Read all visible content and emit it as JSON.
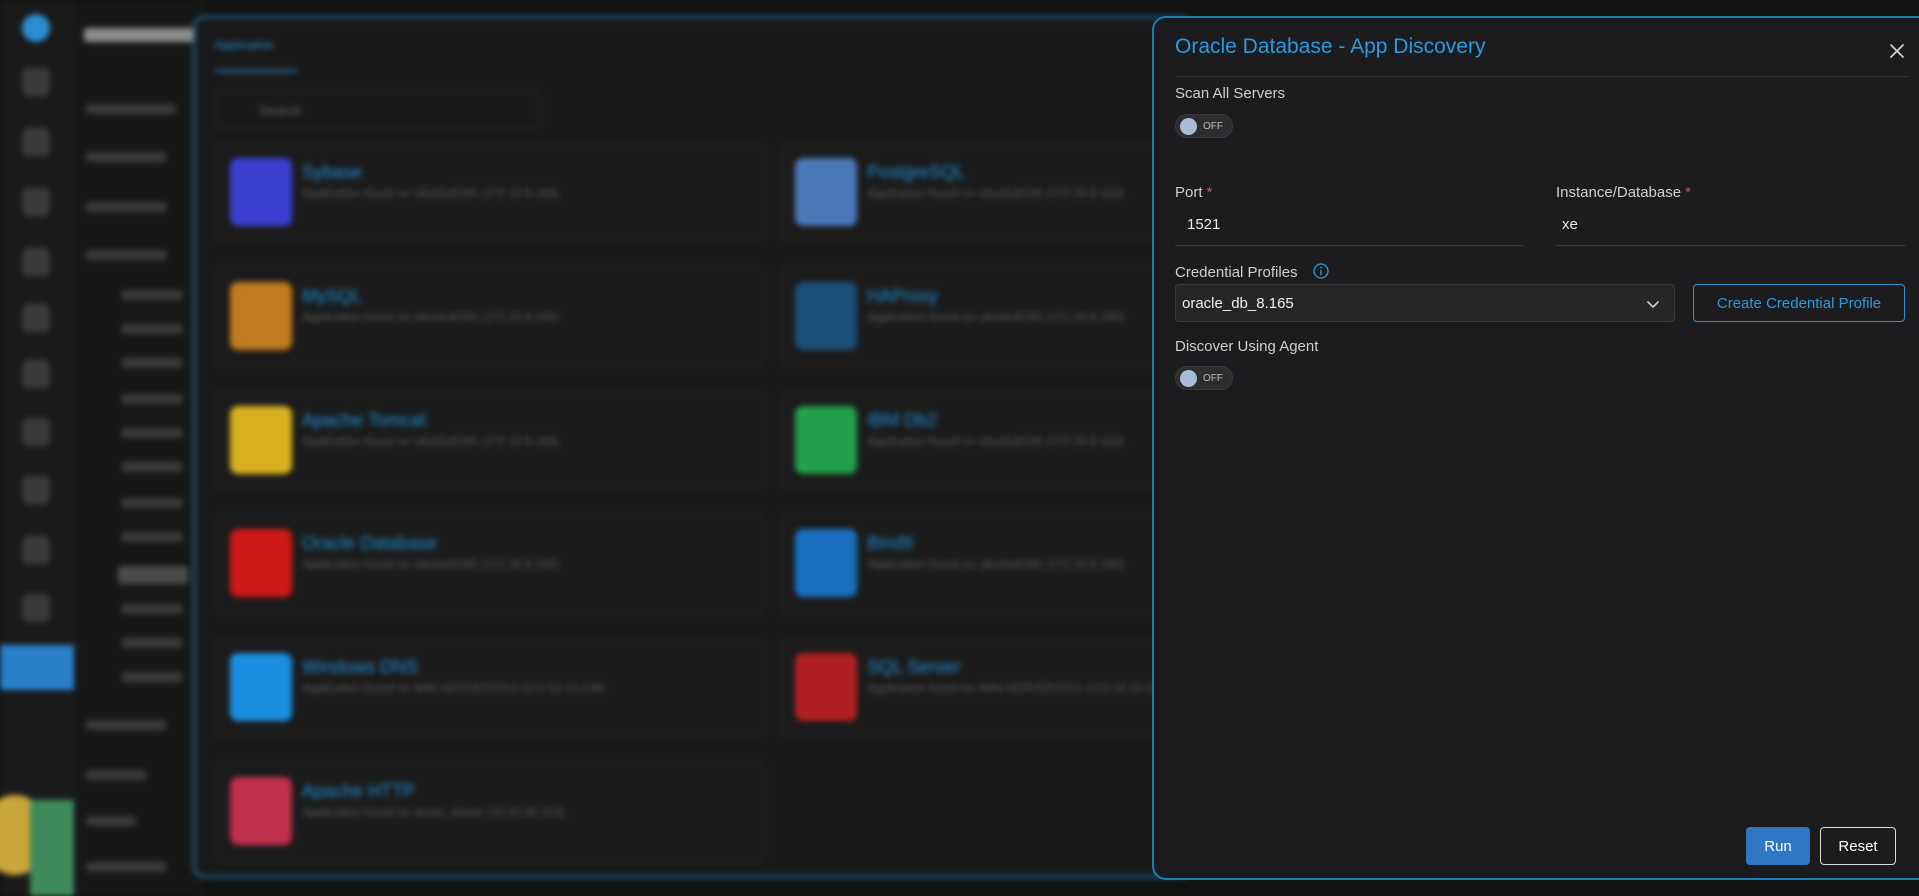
{
  "drawer": {
    "title": "Oracle Database - App Discovery",
    "scan_all_servers_label": "Scan All Servers",
    "scan_all_servers_state": "OFF",
    "port_label": "Port",
    "port_value": "1521",
    "instance_label": "Instance/Database",
    "instance_value": "xe",
    "required_mark": "*",
    "credential_label": "Credential Profiles",
    "credential_selected": "oracle_db_8.165",
    "create_credential_label": "Create Credential Profile",
    "agent_label": "Discover Using Agent",
    "agent_state": "OFF",
    "run_label": "Run",
    "reset_label": "Reset"
  },
  "background": {
    "tab_label": "Application",
    "search_placeholder": "Search",
    "apps": [
      {
        "name": "Sybase",
        "sub": "Application found on ubuntu8165 (172.16.8.165)",
        "color": "#3b3fd0"
      },
      {
        "name": "PostgreSQL",
        "sub": "Application found on ubuntu8165 (172.16.8.165)",
        "color": "#4a78b8"
      },
      {
        "name": "MySQL",
        "sub": "Application found on ubuntu8165 (172.16.8.165)",
        "color": "#c07a20"
      },
      {
        "name": "HAProxy",
        "sub": "Application found on ubuntu8165 (172.16.8.165)",
        "color": "#1a4f7a"
      },
      {
        "name": "Apache Tomcat",
        "sub": "Application found on ubuntu8165 (172.16.8.165)",
        "color": "#d6b020"
      },
      {
        "name": "IBM Db2",
        "sub": "Application found on ubuntu8165 (172.16.8.165)",
        "color": "#22a04a"
      },
      {
        "name": "Oracle Database",
        "sub": "Application found on ubuntu8165 (172.16.8.165)",
        "color": "#d01818"
      },
      {
        "name": "Bind9",
        "sub": "Application found on ubuntu8165 (172.16.8.165)",
        "color": "#1a6fc0"
      },
      {
        "name": "Windows DNS",
        "sub": "Application found on WIN-SERVER2012 (172.16.10.236)",
        "color": "#1a8fe0"
      },
      {
        "name": "SQL Server",
        "sub": "Application found on WIN-SERVER2012 (172.16.10.236)",
        "color": "#b02020"
      },
      {
        "name": "Apache HTTP",
        "sub": "Application found on aman_dasari (10.20.40.213)",
        "color": "#c0304a"
      }
    ]
  },
  "colors": {
    "accent": "#2b9ae0",
    "primary_button": "#2f77c4",
    "required": "#e04848"
  }
}
